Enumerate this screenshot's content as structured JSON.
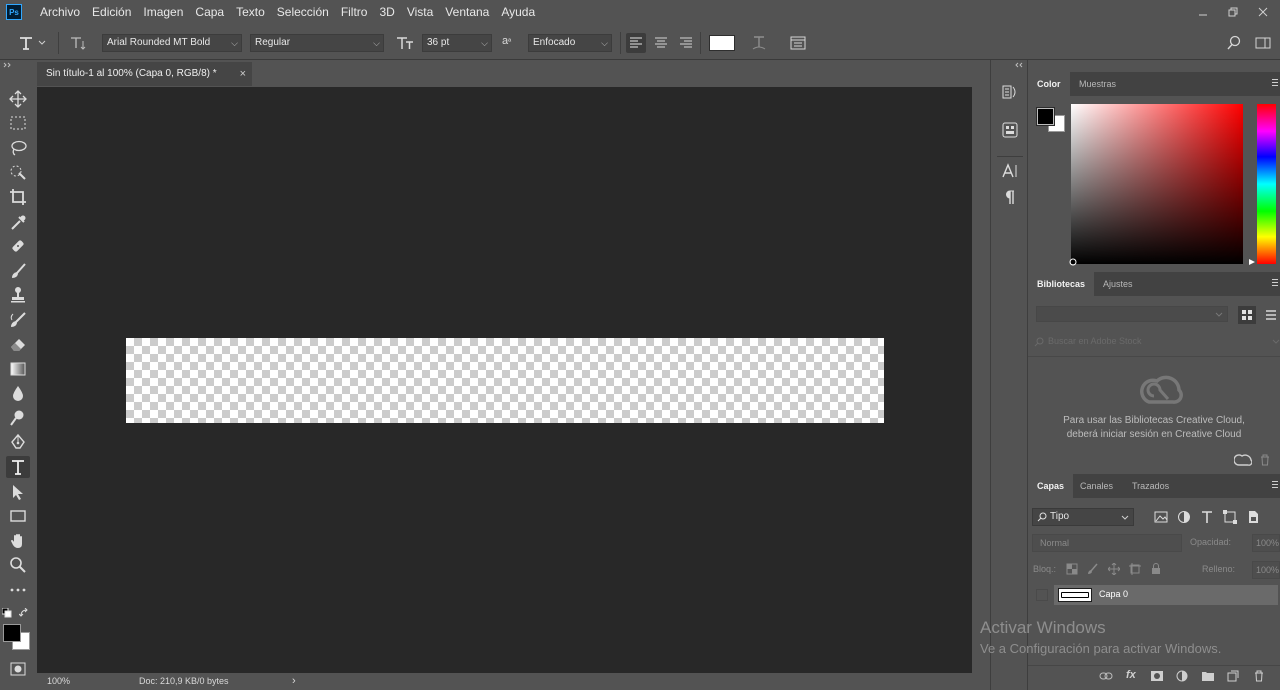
{
  "app": {
    "logo_text": "Ps"
  },
  "menu": [
    "Archivo",
    "Edición",
    "Imagen",
    "Capa",
    "Texto",
    "Selección",
    "Filtro",
    "3D",
    "Vista",
    "Ventana",
    "Ayuda"
  ],
  "options": {
    "font_family": "Arial Rounded MT Bold",
    "font_style": "Regular",
    "font_size": "36 pt",
    "aa_label": "a",
    "antialias": "Enfocado",
    "text_color": "#ffffff"
  },
  "document": {
    "tab_title": "Sin título-1 al 100% (Capa 0, RGB/8) *",
    "close": "×",
    "zoom": "100%",
    "doc_info": "Doc: 210,9 KB/0 bytes",
    "arrow": "›"
  },
  "tools": [
    "move-tool",
    "marquee-tool",
    "lasso-tool",
    "quick-select-tool",
    "crop-tool",
    "eyedropper-tool",
    "healing-tool",
    "brush-tool",
    "stamp-tool",
    "history-brush-tool",
    "eraser-tool",
    "gradient-tool",
    "blur-tool",
    "dodge-tool",
    "pen-tool",
    "type-tool",
    "path-select-tool",
    "rectangle-tool",
    "hand-tool",
    "zoom-tool",
    "more-tools"
  ],
  "color_panel": {
    "tabs": [
      "Color",
      "Muestras"
    ],
    "foreground": "#000000",
    "background": "#ffffff",
    "hue": "#ff0000"
  },
  "libraries_panel": {
    "tabs": [
      "Bibliotecas",
      "Ajustes"
    ],
    "search_placeholder": "Buscar en Adobe Stock",
    "message_line1": "Para usar las Bibliotecas Creative Cloud,",
    "message_line2": "deberá iniciar sesión en Creative Cloud"
  },
  "layers_panel": {
    "tabs": [
      "Capas",
      "Canales",
      "Trazados"
    ],
    "filter": "Tipo",
    "blend_mode": "Normal",
    "opacity_label": "Opacidad:",
    "opacity_value": "100%",
    "lock_label": "Bloq.:",
    "fill_label": "Relleno:",
    "fill_value": "100%",
    "layers": [
      {
        "name": "Capa 0"
      }
    ]
  },
  "watermark": {
    "line1": "Activar Windows",
    "line2": "Ve a Configuración para activar Windows."
  }
}
